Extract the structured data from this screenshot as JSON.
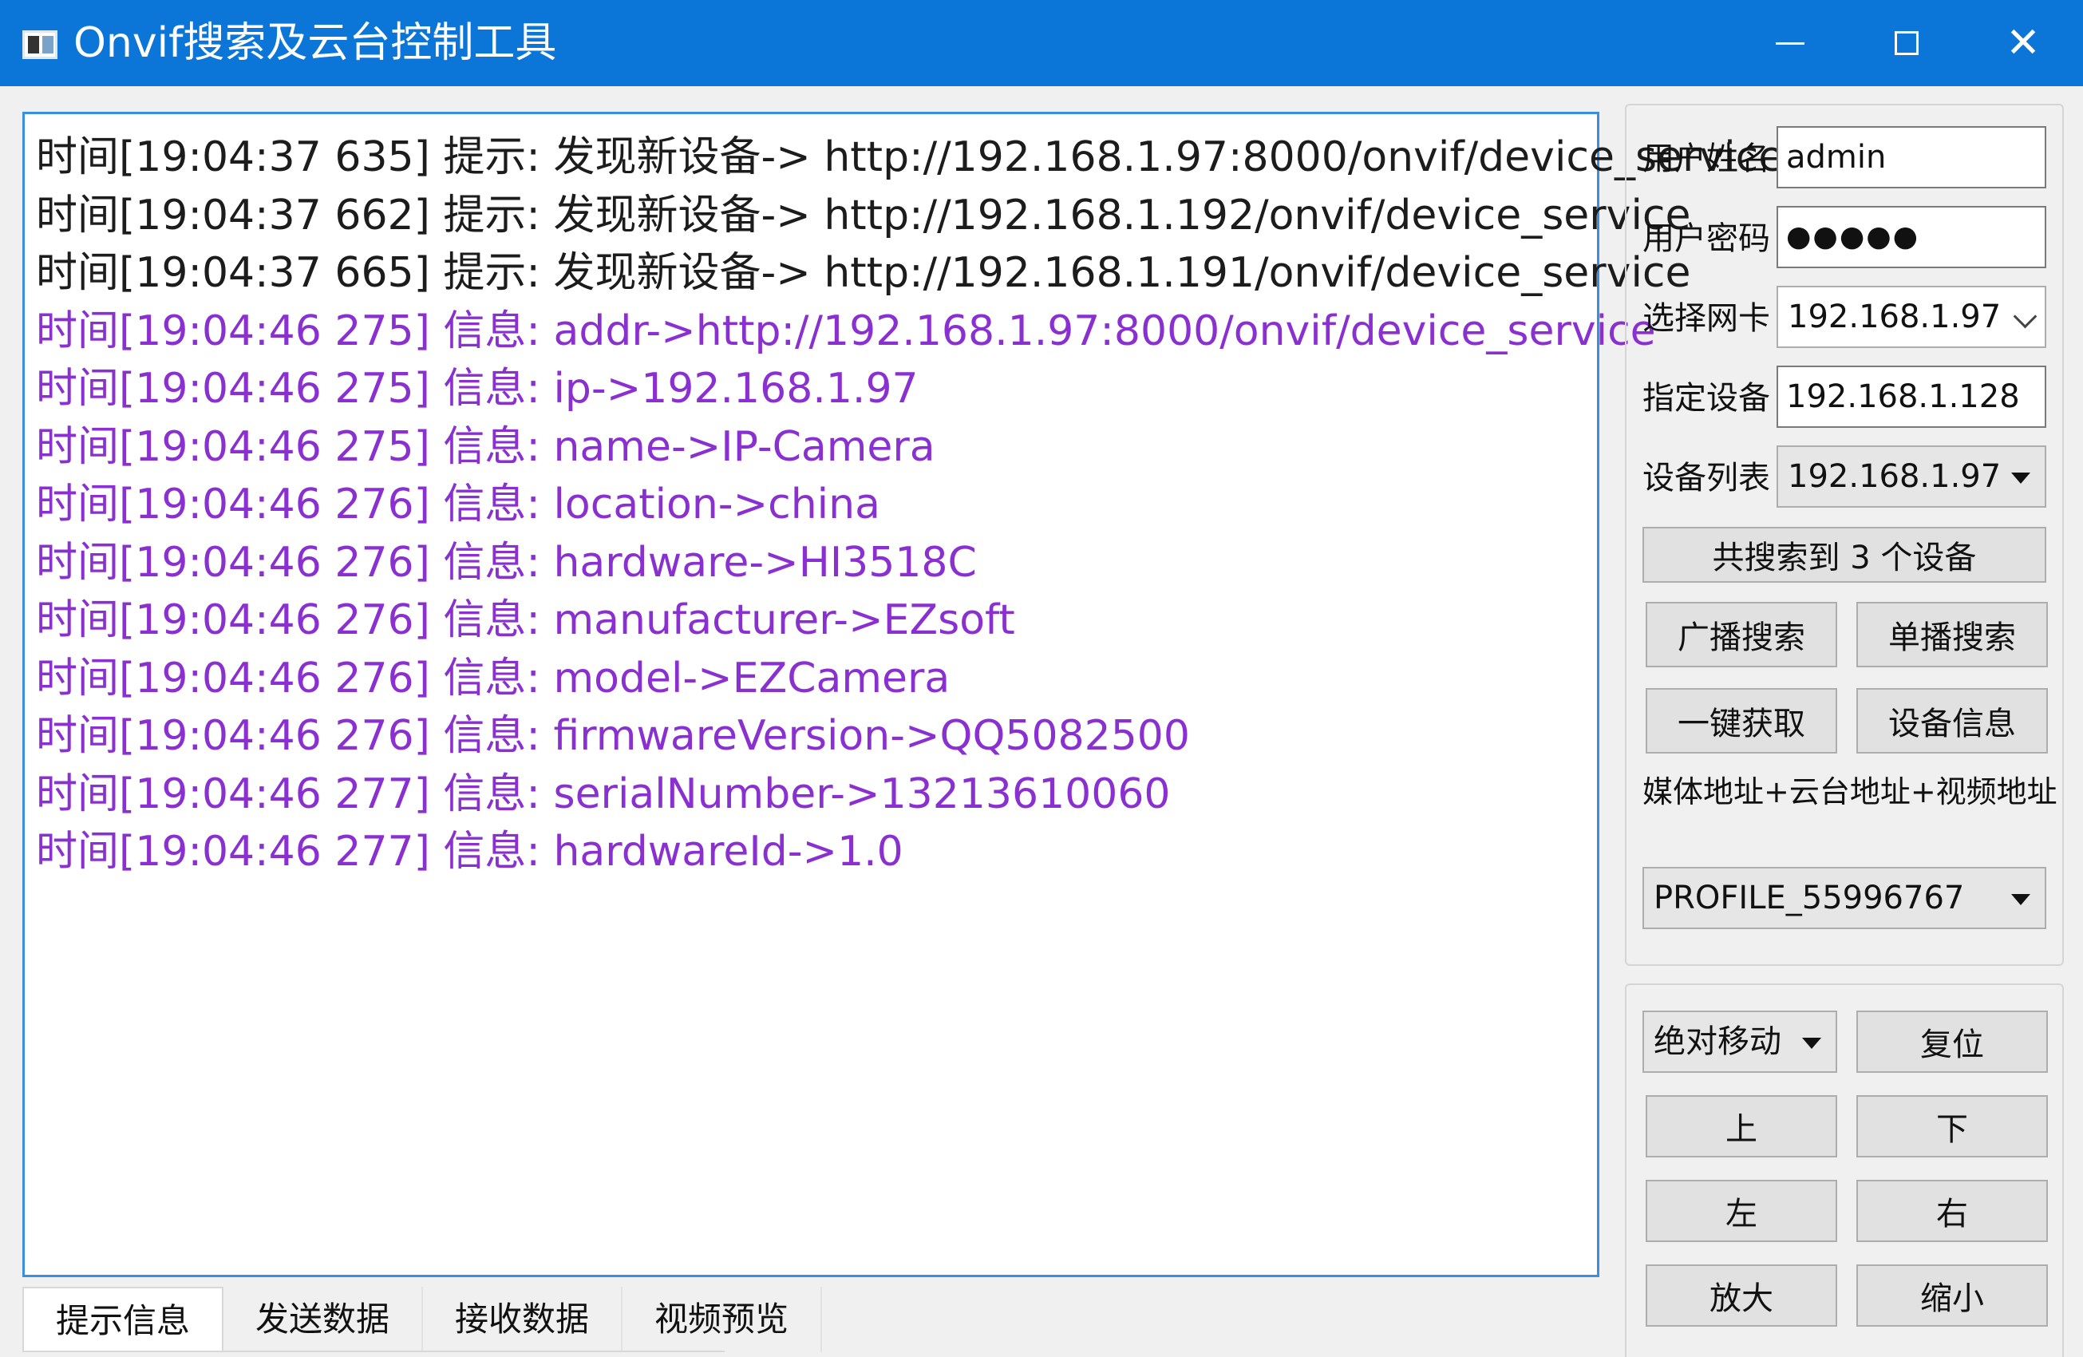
{
  "window": {
    "title": "Onvif搜索及云台控制工具",
    "minimize": "minimize",
    "maximize": "maximize",
    "close": "✕"
  },
  "log": [
    {
      "text": "时间[19:04:37 635] 提示: 发现新设备-> http://192.168.1.97:8000/onvif/device_service",
      "kind": "tip"
    },
    {
      "text": "时间[19:04:37 662] 提示: 发现新设备-> http://192.168.1.192/onvif/device_service",
      "kind": "tip"
    },
    {
      "text": "时间[19:04:37 665] 提示: 发现新设备-> http://192.168.1.191/onvif/device_service",
      "kind": "tip"
    },
    {
      "text": "时间[19:04:46 275] 信息: addr->http://192.168.1.97:8000/onvif/device_service",
      "kind": "info"
    },
    {
      "text": "时间[19:04:46 275] 信息: ip->192.168.1.97",
      "kind": "info"
    },
    {
      "text": "时间[19:04:46 275] 信息: name->IP-Camera",
      "kind": "info"
    },
    {
      "text": "时间[19:04:46 276] 信息: location->china",
      "kind": "info"
    },
    {
      "text": "时间[19:04:46 276] 信息: hardware->HI3518C",
      "kind": "info"
    },
    {
      "text": "时间[19:04:46 276] 信息: manufacturer->EZsoft",
      "kind": "info"
    },
    {
      "text": "时间[19:04:46 276] 信息: model->EZCamera",
      "kind": "info"
    },
    {
      "text": "时间[19:04:46 276] 信息: firmwareVersion->QQ5082500",
      "kind": "info"
    },
    {
      "text": "时间[19:04:46 277] 信息: serialNumber->13213610060",
      "kind": "info"
    },
    {
      "text": "时间[19:04:46 277] 信息: hardwareId->1.0",
      "kind": "info"
    }
  ],
  "colors": {
    "tip": "#1c1c1c",
    "info": "#8a2fd0",
    "titlebar": "#0b76d8"
  },
  "tabs": [
    "提示信息",
    "发送数据",
    "接收数据",
    "视频预览"
  ],
  "form": {
    "username_label": "用户姓名",
    "username_value": "admin",
    "password_label": "用户密码",
    "password_value": "●●●●●",
    "nic_label": "选择网卡",
    "nic_value": "192.168.1.97",
    "device_label": "指定设备",
    "device_value": "192.168.1.128",
    "list_label": "设备列表",
    "list_value": "192.168.1.97"
  },
  "buttons": {
    "found": "共搜索到 3 个设备",
    "broadcast": "广播搜索",
    "unicast": "单播搜索",
    "onekey": "一键获取",
    "devinfo": "设备信息"
  },
  "note": "媒体地址+云台地址+视频地址",
  "profile": "PROFILE_55996767",
  "ptz": {
    "mode": "绝对移动",
    "reset": "复位",
    "up": "上",
    "down": "下",
    "left": "左",
    "right": "右",
    "zoom_in": "放大",
    "zoom_out": "缩小"
  }
}
